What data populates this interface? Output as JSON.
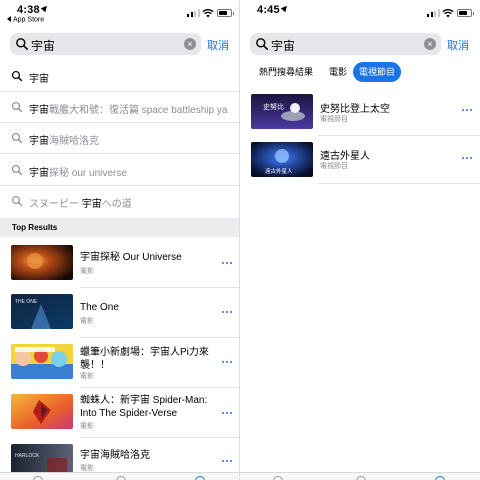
{
  "left": {
    "status": {
      "time": "4:38",
      "back_app": "App Store"
    },
    "search": {
      "query": "宇宙",
      "cancel": "取消"
    },
    "suggestions": [
      {
        "pre": "",
        "hl": "宇宙",
        "post": ""
      },
      {
        "pre": "",
        "hl": "宇宙",
        "post": "戰艦大和號：復活篇 space battleship ya"
      },
      {
        "pre": "",
        "hl": "宇宙",
        "post": "海賊哈洛克"
      },
      {
        "pre": "",
        "hl": "宇宙",
        "post": "探秘 our universe"
      },
      {
        "pre": "スヌーピー ",
        "hl": "宇宙",
        "post": "への道"
      }
    ],
    "section_header": "Top Results",
    "results": [
      {
        "title": "宇宙探秘 Our Universe",
        "subtitle": "電影"
      },
      {
        "title": "The One",
        "subtitle": "電影"
      },
      {
        "title": "蠟筆小新劇場：宇宙人Pi力來襲！！",
        "subtitle": "電影"
      },
      {
        "title": "蜘蛛人：新宇宙 Spider-Man: Into The Spider-Verse",
        "subtitle": "電影"
      },
      {
        "title": "宇宙海賊哈洛克",
        "subtitle": "電影"
      }
    ],
    "thumb_texts": {
      "the_one": "THE ONE",
      "harlock": "HARLOCK"
    }
  },
  "right": {
    "status": {
      "time": "4:45"
    },
    "search": {
      "query": "宇宙",
      "cancel": "取消"
    },
    "tabs": [
      {
        "label": "熱門搜尋結果",
        "active": false
      },
      {
        "label": "電影",
        "active": false
      },
      {
        "label": "電視節目",
        "active": true
      }
    ],
    "results": [
      {
        "title": "史努比登上太空",
        "subtitle": "電視節目",
        "thumb_text": "史努比"
      },
      {
        "title": "遠古外星人",
        "subtitle": "電視節目",
        "thumb_text": "遠古外星人"
      }
    ]
  },
  "colors": {
    "accent": "#1a73e8",
    "secondary_text": "#8e8e93",
    "search_bg": "#e6e6eb"
  }
}
